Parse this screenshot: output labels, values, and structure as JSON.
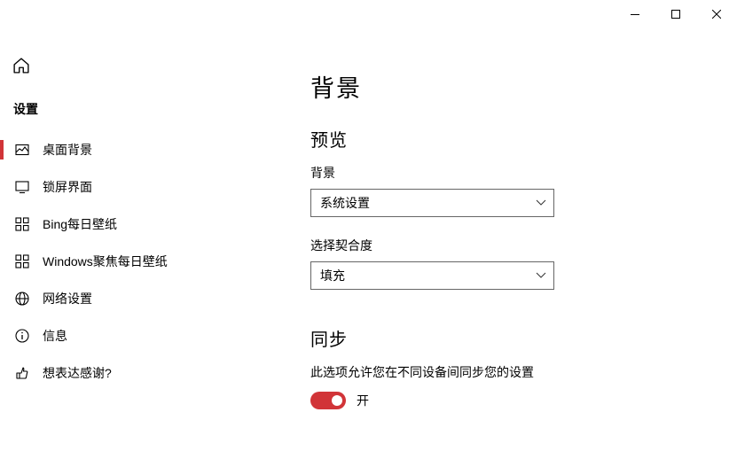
{
  "sidebar": {
    "title": "设置",
    "items": [
      {
        "label": "桌面背景"
      },
      {
        "label": "锁屏界面"
      },
      {
        "label": "Bing每日壁纸"
      },
      {
        "label": "Windows聚焦每日壁纸"
      },
      {
        "label": "网络设置"
      },
      {
        "label": "信息"
      },
      {
        "label": "想表达感谢?"
      }
    ]
  },
  "page": {
    "title": "背景",
    "preview_header": "预览",
    "background_label": "背景",
    "background_value": "系统设置",
    "fit_label": "选择契合度",
    "fit_value": "填充",
    "sync_header": "同步",
    "sync_desc": "此选项允许您在不同设备间同步您的设置",
    "sync_toggle_label": "开"
  }
}
